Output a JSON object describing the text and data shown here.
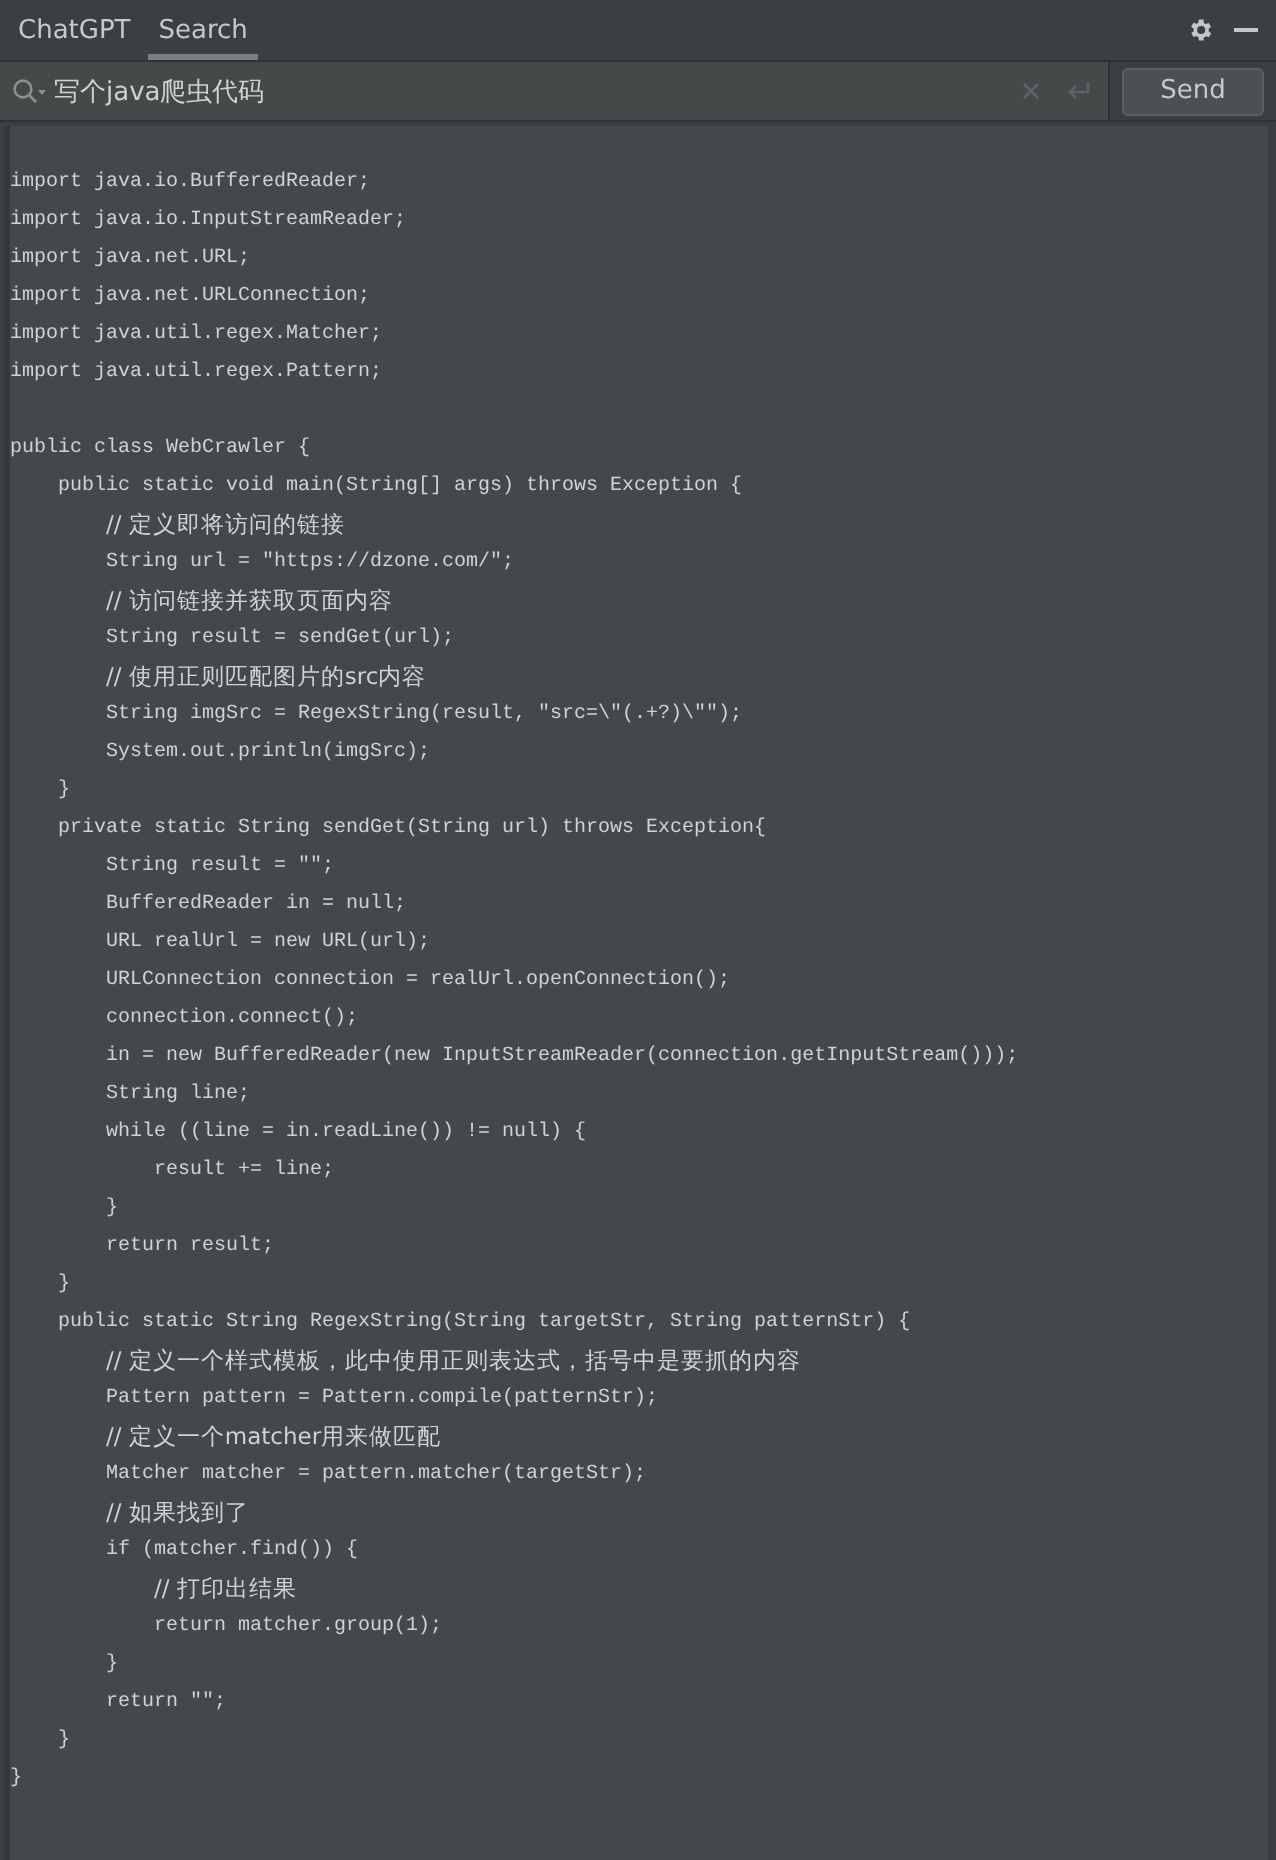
{
  "tabs": [
    {
      "label": "ChatGPT",
      "selected": false
    },
    {
      "label": "Search",
      "selected": true
    }
  ],
  "search": {
    "value": "写个java爬虫代码"
  },
  "send_button": "Send",
  "code_lines": [
    {
      "kind": "blank"
    },
    {
      "kind": "code",
      "text": "import java.io.BufferedReader;"
    },
    {
      "kind": "code",
      "text": "import java.io.InputStreamReader;"
    },
    {
      "kind": "code",
      "text": "import java.net.URL;"
    },
    {
      "kind": "code",
      "text": "import java.net.URLConnection;"
    },
    {
      "kind": "code",
      "text": "import java.util.regex.Matcher;"
    },
    {
      "kind": "code",
      "text": "import java.util.regex.Pattern;"
    },
    {
      "kind": "blank"
    },
    {
      "kind": "code",
      "text": "public class WebCrawler {"
    },
    {
      "kind": "code",
      "text": "    public static void main(String[] args) throws Exception {"
    },
    {
      "kind": "comment",
      "text": "        // 定义即将访问的链接"
    },
    {
      "kind": "code",
      "text": "        String url = \"https://dzone.com/\";"
    },
    {
      "kind": "comment",
      "text": "        // 访问链接并获取页面内容"
    },
    {
      "kind": "code",
      "text": "        String result = sendGet(url);"
    },
    {
      "kind": "comment",
      "text": "        // 使用正则匹配图片的src内容"
    },
    {
      "kind": "code",
      "text": "        String imgSrc = RegexString(result, \"src=\\\"(.+?)\\\"\");"
    },
    {
      "kind": "code",
      "text": "        System.out.println(imgSrc);"
    },
    {
      "kind": "code",
      "text": "    }"
    },
    {
      "kind": "code",
      "text": "    private static String sendGet(String url) throws Exception{"
    },
    {
      "kind": "code",
      "text": "        String result = \"\";"
    },
    {
      "kind": "code",
      "text": "        BufferedReader in = null;"
    },
    {
      "kind": "code",
      "text": "        URL realUrl = new URL(url);"
    },
    {
      "kind": "code",
      "text": "        URLConnection connection = realUrl.openConnection();"
    },
    {
      "kind": "code",
      "text": "        connection.connect();"
    },
    {
      "kind": "code",
      "text": "        in = new BufferedReader(new InputStreamReader(connection.getInputStream()));"
    },
    {
      "kind": "code",
      "text": "        String line;"
    },
    {
      "kind": "code",
      "text": "        while ((line = in.readLine()) != null) {"
    },
    {
      "kind": "code",
      "text": "            result += line;"
    },
    {
      "kind": "code",
      "text": "        }"
    },
    {
      "kind": "code",
      "text": "        return result;"
    },
    {
      "kind": "code",
      "text": "    }"
    },
    {
      "kind": "code",
      "text": "    public static String RegexString(String targetStr, String patternStr) {"
    },
    {
      "kind": "comment",
      "text": "        // 定义一个样式模板，此中使用正则表达式，括号中是要抓的内容"
    },
    {
      "kind": "code",
      "text": "        Pattern pattern = Pattern.compile(patternStr);"
    },
    {
      "kind": "comment",
      "text": "        // 定义一个matcher用来做匹配"
    },
    {
      "kind": "code",
      "text": "        Matcher matcher = pattern.matcher(targetStr);"
    },
    {
      "kind": "comment",
      "text": "        // 如果找到了"
    },
    {
      "kind": "code",
      "text": "        if (matcher.find()) {"
    },
    {
      "kind": "comment",
      "text": "            // 打印出结果"
    },
    {
      "kind": "code",
      "text": "            return matcher.group(1);"
    },
    {
      "kind": "code",
      "text": "        }"
    },
    {
      "kind": "code",
      "text": "        return \"\";"
    },
    {
      "kind": "code",
      "text": "    }"
    },
    {
      "kind": "code",
      "text": "}"
    }
  ]
}
